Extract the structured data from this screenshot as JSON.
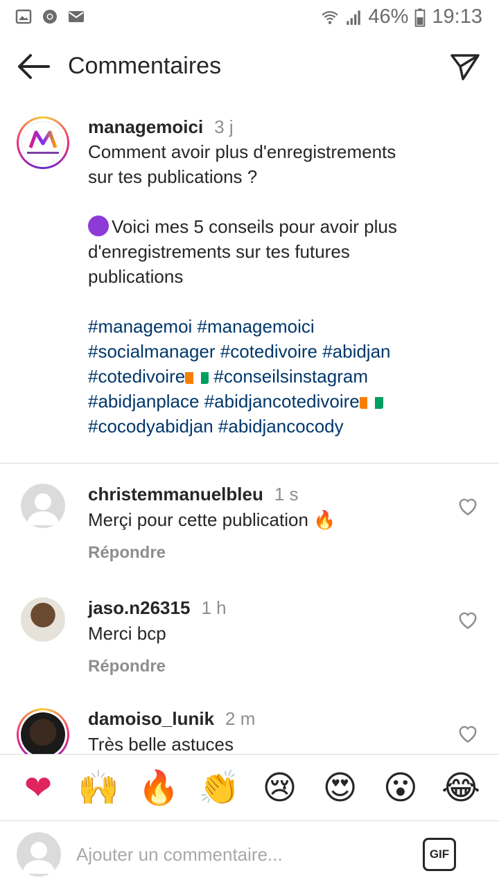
{
  "status_bar": {
    "battery": "46%",
    "time": "19:13"
  },
  "header": {
    "title": "Commentaires"
  },
  "caption": {
    "username": "managemoici",
    "time": "3 j",
    "line1": "Comment avoir plus d'enregistrements\nsur tes publications ?",
    "line2": "Voici mes 5 conseils pour avoir plus\nd'enregistrements sur tes futures\npublications",
    "hashtags": {
      "h1": "#managemoi #managemoici",
      "h2": "#socialmanager #cotedivoire #abidjan",
      "h3a": "#cotedivoire",
      "h3b": " #conseilsinstagram",
      "h4a": "#abidjanplace #abidjancotedivoire",
      "h5": "#cocodyabidjan #abidjancocody"
    }
  },
  "comments": [
    {
      "username": "christemmanuelbleu",
      "time": "1 s",
      "text": "Merçi pour cette publication 🔥",
      "reply": "Répondre"
    },
    {
      "username": "jaso.n26315",
      "time": "1 h",
      "text": "Merci bcp",
      "reply": "Répondre"
    },
    {
      "username": "damoiso_lunik",
      "time": "2 m",
      "text": "Très belle astuces"
    }
  ],
  "emoji_bar": [
    "❤",
    "🙌",
    "🔥",
    "👏",
    "😢",
    "😍",
    "😮",
    "😂"
  ],
  "input": {
    "placeholder": "Ajouter un commentaire...",
    "gif_label": "GIF"
  },
  "colors": {
    "hashtag": "#00376b",
    "muted": "#8e8e8e",
    "text": "#262626"
  }
}
